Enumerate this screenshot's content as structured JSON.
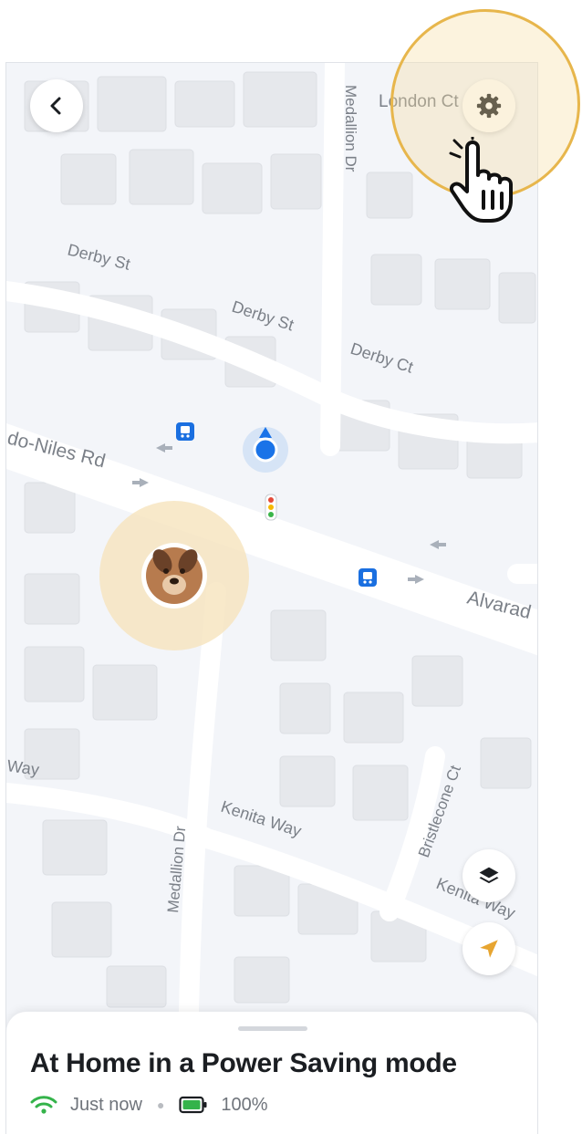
{
  "map": {
    "streets": {
      "london_ct": "London Ct",
      "medallion_dr_top": "Medallion Dr",
      "derby_st_1": "Derby St",
      "derby_st_2": "Derby St",
      "derby_ct": "Derby Ct",
      "alvarado_niles_left": "do-Niles Rd",
      "alvarado_right": "Alvarad",
      "way_left": "Way",
      "kenita_way_1": "Kenita Way",
      "kenita_way_2": "Kenita Way",
      "medallion_dr_bottom": "Medallion Dr",
      "bristlecone_ct": "Bristlecone Ct"
    },
    "colors": {
      "background": "#f3f5f9",
      "road": "#ffffff",
      "building": "#e6e8ec",
      "pet_halo": "#f6e4bd",
      "user_dot": "#1a73e8",
      "transit": "#1a6fe0"
    }
  },
  "status": {
    "title": "At Home in a Power Saving mode",
    "updated": "Just now",
    "battery": "100%",
    "wifi_color": "#34b34a",
    "battery_color": "#34b34a"
  },
  "accent": "#e7b64c"
}
